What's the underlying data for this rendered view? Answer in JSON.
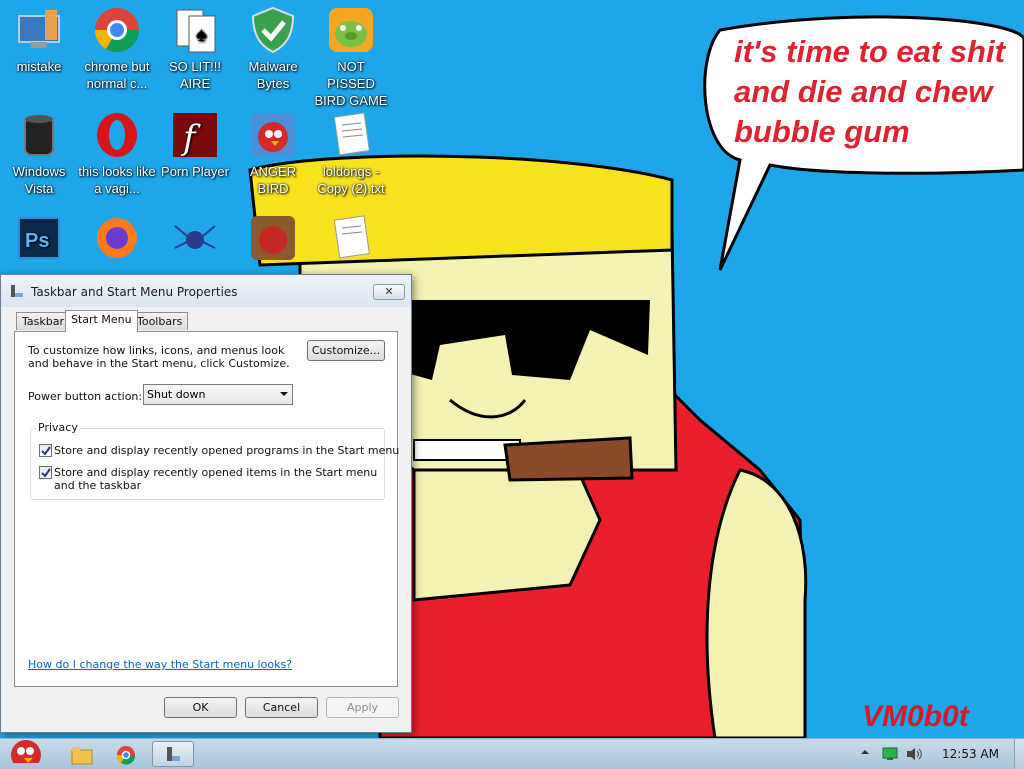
{
  "wallpaper": {
    "speech_text": "it's time to eat shit\nand die and chew\nbubble gum",
    "signature": "VM0b0t",
    "bg_color": "#1ea6ea"
  },
  "desktop_icons": [
    {
      "label": "mistake",
      "icon": "computer-icon"
    },
    {
      "label": "chrome but normal c...",
      "icon": "chrome-icon"
    },
    {
      "label": "SO LIT!!! AIRE",
      "icon": "solitaire-icon"
    },
    {
      "label": "Malware Bytes",
      "icon": "shield-icon"
    },
    {
      "label": "NOT PISSED BIRD GAME",
      "icon": "pig-icon"
    },
    {
      "label": "Windows Vista",
      "icon": "trash-icon"
    },
    {
      "label": "this looks like a vagi...",
      "icon": "opera-icon"
    },
    {
      "label": "Porn Player",
      "icon": "flash-icon"
    },
    {
      "label": "ANGER BIRD",
      "icon": "angry-bird-icon"
    },
    {
      "label": "loldongs - Copy (2).txt",
      "icon": "text-file-icon"
    },
    {
      "label": "",
      "icon": "photoshop-icon"
    },
    {
      "label": "",
      "icon": "firefox-icon"
    },
    {
      "label": "",
      "icon": "spider-icon"
    },
    {
      "label": "",
      "icon": "angry-bird-seasons-icon"
    },
    {
      "label": "",
      "icon": "text-file-icon"
    }
  ],
  "dialog": {
    "title": "Taskbar and Start Menu Properties",
    "close_label": "✕",
    "tabs": [
      "Taskbar",
      "Start Menu",
      "Toolbars"
    ],
    "active_tab": "Start Menu",
    "description": "To customize how links, icons, and menus look and behave in the Start menu, click Customize.",
    "customize_label": "Customize...",
    "power_label": "Power button action:",
    "power_value": "Shut down",
    "privacy_label": "Privacy",
    "checkbox_programs": "Store and display recently opened programs in the Start menu",
    "checkbox_items": "Store and display recently opened items in the Start menu and the taskbar",
    "programs_checked": true,
    "items_checked": true,
    "help_link": "How do I change the way the Start menu looks?",
    "ok_label": "OK",
    "cancel_label": "Cancel",
    "apply_label": "Apply"
  },
  "taskbar": {
    "clock": "12:53 AM",
    "items": [
      "start-orb",
      "explorer-icon",
      "chrome-icon",
      "properties-window-icon"
    ]
  }
}
